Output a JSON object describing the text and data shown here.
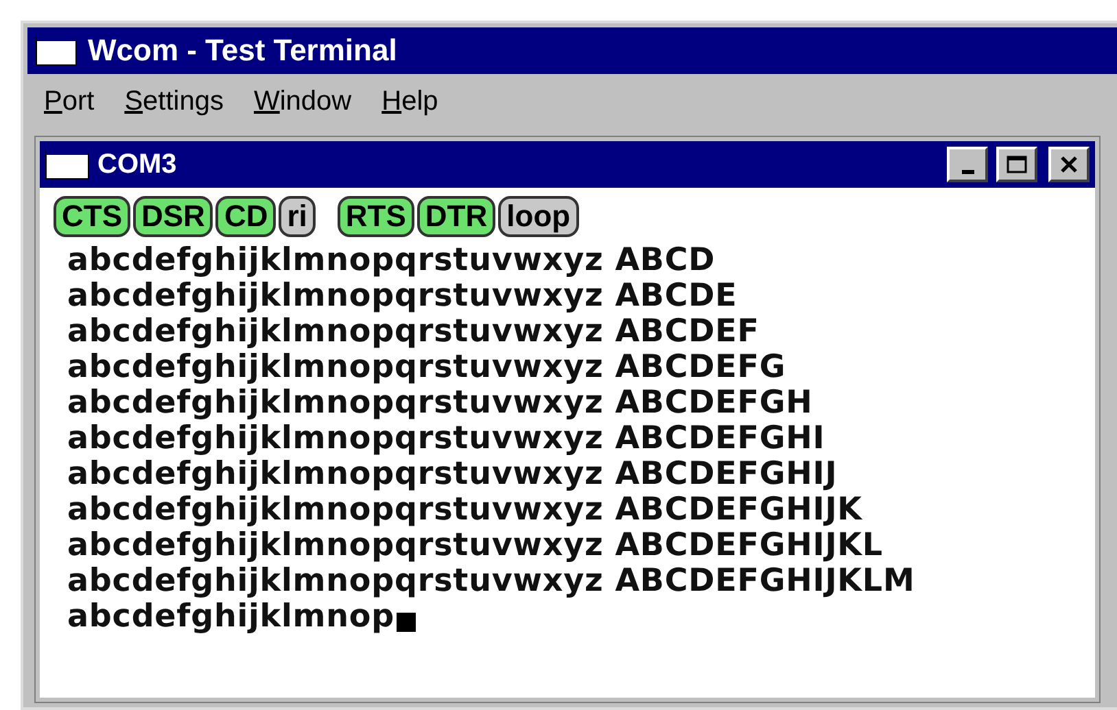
{
  "window": {
    "title": "Wcom - Test Terminal"
  },
  "menu": [
    {
      "label": "Port"
    },
    {
      "label": "Settings"
    },
    {
      "label": "Window"
    },
    {
      "label": "Help"
    }
  ],
  "child_window": {
    "title": "COM3"
  },
  "signals": [
    {
      "label": "CTS",
      "on": true
    },
    {
      "label": "DSR",
      "on": true
    },
    {
      "label": "CD",
      "on": true
    },
    {
      "label": "ri",
      "on": false
    },
    {
      "label": "RTS",
      "on": true,
      "gap_before": true
    },
    {
      "label": "DTR",
      "on": true
    },
    {
      "label": "loop",
      "on": false
    }
  ],
  "terminal_lines": [
    "abcdefghijklmnopqrstuvwxyz ABCD",
    "abcdefghijklmnopqrstuvwxyz ABCDE",
    "abcdefghijklmnopqrstuvwxyz ABCDEF",
    "abcdefghijklmnopqrstuvwxyz ABCDEFG",
    "abcdefghijklmnopqrstuvwxyz ABCDEFGH",
    "abcdefghijklmnopqrstuvwxyz ABCDEFGHI",
    "abcdefghijklmnopqrstuvwxyz ABCDEFGHIJ",
    "abcdefghijklmnopqrstuvwxyz ABCDEFGHIJK",
    "abcdefghijklmnopqrstuvwxyz ABCDEFGHIJKL",
    "abcdefghijklmnopqrstuvwxyz ABCDEFGHIJKLM",
    "abcdefghijklmnop"
  ]
}
